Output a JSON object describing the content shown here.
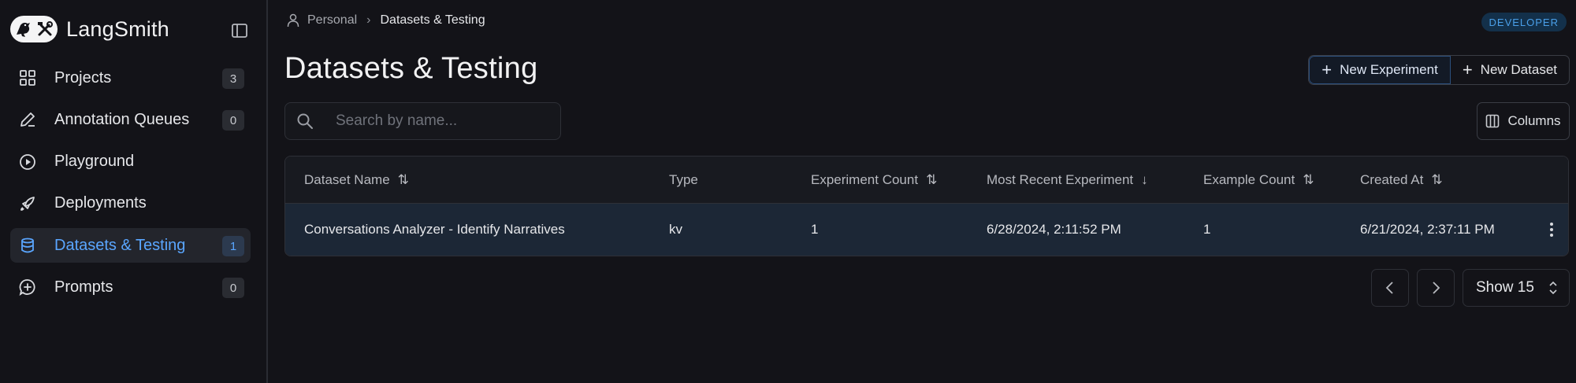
{
  "app": {
    "name": "LangSmith"
  },
  "sidebar": {
    "items": [
      {
        "label": "Projects",
        "icon": "grid-icon",
        "badge": "3",
        "active": false
      },
      {
        "label": "Annotation Queues",
        "icon": "pen-icon",
        "badge": "0",
        "active": false
      },
      {
        "label": "Playground",
        "icon": "play-circle-icon",
        "badge": "",
        "active": false
      },
      {
        "label": "Deployments",
        "icon": "rocket-icon",
        "badge": "",
        "active": false
      },
      {
        "label": "Datasets & Testing",
        "icon": "database-icon",
        "badge": "1",
        "active": true
      },
      {
        "label": "Prompts",
        "icon": "message-plus-icon",
        "badge": "0",
        "active": false
      }
    ]
  },
  "breadcrumb": {
    "root": "Personal",
    "current": "Datasets & Testing"
  },
  "header": {
    "badge": "DEVELOPER",
    "title": "Datasets & Testing",
    "new_experiment": "New Experiment",
    "new_dataset": "New Dataset"
  },
  "search": {
    "placeholder": "Search by name..."
  },
  "columns_button": "Columns",
  "table": {
    "headers": [
      "Dataset Name",
      "Type",
      "Experiment Count",
      "Most Recent Experiment",
      "Example Count",
      "Created At"
    ],
    "rows": [
      [
        "Conversations Analyzer - Identify Narratives",
        "kv",
        "1",
        "6/28/2024, 2:11:52 PM",
        "1",
        "6/21/2024, 2:37:11 PM"
      ]
    ]
  },
  "pager": {
    "show_label": "Show 15"
  },
  "colors": {
    "accent": "#5aa6ff",
    "background": "#131318",
    "row_highlight": "#1c2736"
  }
}
